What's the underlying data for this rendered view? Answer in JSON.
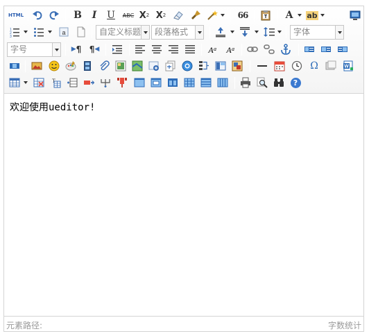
{
  "toolbar": {
    "html_label": "HTML",
    "bold_label": "B",
    "italic_label": "I",
    "underline_label": "U",
    "strike_label": "ABC",
    "superscript_label": "X",
    "subscript_label": "X",
    "quote_label": "66",
    "forecolor_label": "A",
    "backcolor_label": "ab",
    "heading_combo": "自定义标题",
    "paragraph_combo": "段落格式",
    "font_family_combo": "字体",
    "font_size_combo": "字号",
    "rtl_label": "¶",
    "ltr_label": "¶",
    "omega_label": "Ω",
    "help_label": "?"
  },
  "editor": {
    "content_text": "欢迎使用ueditor!"
  },
  "statusbar": {
    "element_path_label": "元素路径:",
    "word_count_label": "字数统计"
  },
  "colors": {
    "border": "#d4d4d4",
    "icon_blue": "#3b6fb6",
    "icon_dark": "#333333",
    "status_text": "#999999"
  }
}
